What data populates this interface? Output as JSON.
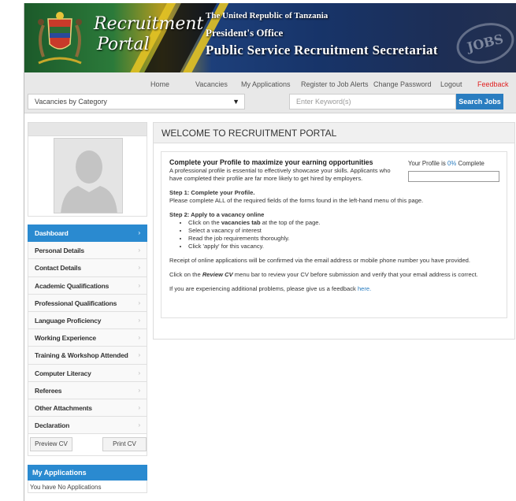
{
  "banner": {
    "portal_title_line1": "Recruitment",
    "portal_title_line2": "Portal",
    "gov_line1": "The United Republic of Tanzania",
    "gov_line2": "President's Office",
    "gov_line3": "Public Service Recruitment Secretariat",
    "stamp_text": "JOBS"
  },
  "nav": {
    "home": "Home",
    "vacancies": "Vacancies",
    "my_applications": "My Applications",
    "register_alerts": "Register to Job Alerts",
    "change_password": "Change Password",
    "logout": "Logout",
    "feedback": "Feedback"
  },
  "search": {
    "category_selected": "Vacancies by Category",
    "keyword_placeholder": "Enter Keyword(s)",
    "search_button": "Search Jobs"
  },
  "sidebar": {
    "menu": [
      {
        "label": "Dashboard",
        "active": true
      },
      {
        "label": "Personal Details"
      },
      {
        "label": "Contact Details"
      },
      {
        "label": "Academic Qualifications"
      },
      {
        "label": "Professional Qualifications"
      },
      {
        "label": "Language Proficiency"
      },
      {
        "label": "Working Experience"
      },
      {
        "label": "Training & Workshop Attended"
      },
      {
        "label": "Computer Literacy"
      },
      {
        "label": "Referees"
      },
      {
        "label": "Other Attachments"
      },
      {
        "label": "Declaration"
      }
    ],
    "preview_cv": "Preview CV",
    "print_cv": "Print CV",
    "my_applications_title": "My Applications",
    "no_applications": "You have No Applications"
  },
  "main": {
    "title": "WELCOME TO RECRUITMENT PORTAL",
    "profile_heading": "Complete your Profile to maximize your earning opportunities",
    "profile_text": "A professional profile is essential to effectively showcase your skills. Applicants who have completed their profile are far more likely to get hired by employers.",
    "profile_status_prefix": "Your Profile is",
    "profile_percent": "0%",
    "profile_status_suffix": "Complete",
    "profile_progress": 0,
    "step1_title": "Step 1: Complete your Profile.",
    "step1_text": "Please complete ALL of the required fields of the forms found in the left-hand menu of this page.",
    "step2_title": "Step 2: Apply to a vacancy online",
    "step2_item1_pre": "Click on the",
    "step2_item1_bold": "vacancies tab",
    "step2_item1_post": "at the top of the page.",
    "step2_item2": "Select a vacancy of interest",
    "step2_item3": "Read the job requirements thoroughly.",
    "step2_item4": "Click 'apply' for this vacancy.",
    "receipt_text": "Receipt of online applications will be confirmed via the email address or mobile phone number you have provided.",
    "review_pre": "Click on the",
    "review_bold": "Review CV",
    "review_post": "menu bar to review your CV before submission and verify that your email address is correct.",
    "problems_pre": "If you are experiencing additional problems, please give us a feedback",
    "problems_link": "here."
  },
  "colors": {
    "accent_blue": "#2a8ad0",
    "feedback_red": "#e02020"
  }
}
